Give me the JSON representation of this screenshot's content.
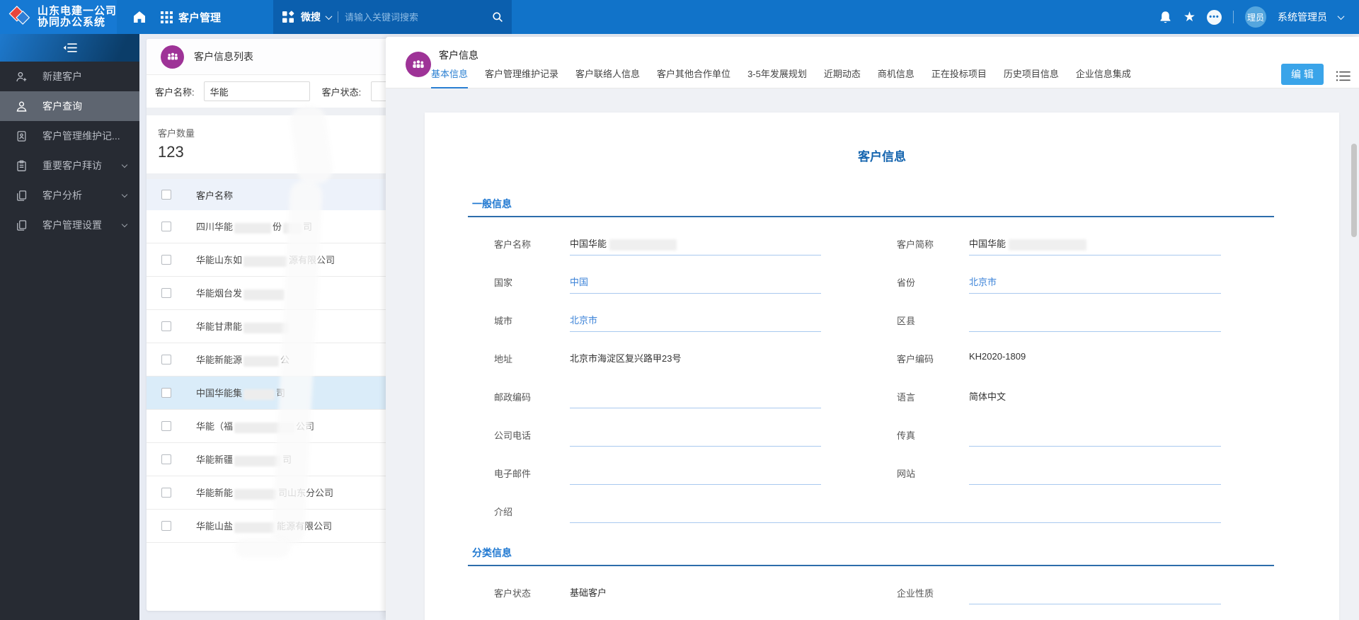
{
  "header": {
    "logo_line1": "山东电建一公司",
    "logo_line2": "协同办公系统",
    "nav_app": "客户管理",
    "wesearch": "微搜",
    "search_placeholder": "请输入关键词搜索",
    "avatar_text": "理员",
    "username": "系统管理员",
    "colors": {
      "bar": "#1173c9",
      "search_panel": "#0b5fae"
    }
  },
  "sidebar": {
    "items": [
      {
        "label": "新建客户",
        "icon": "user-add-icon",
        "selected": false,
        "chevron": false
      },
      {
        "label": "客户查询",
        "icon": "user-icon",
        "selected": true,
        "chevron": false
      },
      {
        "label": "客户管理维护记...",
        "icon": "card-user-icon",
        "selected": false,
        "chevron": false
      },
      {
        "label": "重要客户拜访",
        "icon": "clipboard-icon",
        "selected": false,
        "chevron": true
      },
      {
        "label": "客户分析",
        "icon": "docs-icon",
        "selected": false,
        "chevron": true
      },
      {
        "label": "客户管理设置",
        "icon": "docs-icon",
        "selected": false,
        "chevron": true
      }
    ]
  },
  "list_panel": {
    "title": "客户信息列表",
    "filter_name_label": "客户名称:",
    "filter_name_value": "华能",
    "filter_status_label": "客户状态:",
    "count_label": "客户数量",
    "count_value": "123",
    "table_header": "客户名称",
    "rows": [
      {
        "segments": [
          {
            "t": "四川华能"
          },
          {
            "b": 52
          },
          {
            "t": "份"
          },
          {
            "b": 26
          },
          {
            "t": "司"
          }
        ],
        "selected": false
      },
      {
        "segments": [
          {
            "t": "华能山东如"
          },
          {
            "b": 62
          },
          {
            "t": "源有限公司"
          }
        ],
        "selected": false
      },
      {
        "segments": [
          {
            "t": "华能烟台发"
          },
          {
            "b": 58
          }
        ],
        "selected": false
      },
      {
        "segments": [
          {
            "t": "华能甘肃能"
          },
          {
            "b": 64
          }
        ],
        "selected": false
      },
      {
        "segments": [
          {
            "t": "华能新能源"
          },
          {
            "b": 50
          },
          {
            "t": "公"
          }
        ],
        "selected": false
      },
      {
        "segments": [
          {
            "t": "中国华能集"
          },
          {
            "b": 44
          },
          {
            "t": "司"
          }
        ],
        "selected": true
      },
      {
        "segments": [
          {
            "t": "华能（福"
          },
          {
            "b": 85
          },
          {
            "t": "公司"
          }
        ],
        "selected": false
      },
      {
        "segments": [
          {
            "t": "华能新疆"
          },
          {
            "b": 66
          },
          {
            "t": "司"
          }
        ],
        "selected": false
      },
      {
        "segments": [
          {
            "t": "华能新能"
          },
          {
            "b": 60
          },
          {
            "t": "司山东分公司"
          }
        ],
        "selected": false
      },
      {
        "segments": [
          {
            "t": "华能山盐"
          },
          {
            "b": 58
          },
          {
            "t": "能源有限公司"
          }
        ],
        "selected": false
      }
    ]
  },
  "detail": {
    "title": "客户信息",
    "edit_button": "编 辑",
    "tabs": [
      {
        "label": "基本信息",
        "active": true
      },
      {
        "label": "客户管理维护记录",
        "active": false
      },
      {
        "label": "客户联络人信息",
        "active": false
      },
      {
        "label": "客户其他合作单位",
        "active": false
      },
      {
        "label": "3-5年发展规划",
        "active": false
      },
      {
        "label": "近期动态",
        "active": false
      },
      {
        "label": "商机信息",
        "active": false
      },
      {
        "label": "正在投标项目",
        "active": false
      },
      {
        "label": "历史项目信息",
        "active": false
      },
      {
        "label": "企业信息集成",
        "active": false
      }
    ],
    "form": {
      "title": "客户信息",
      "sections": [
        {
          "title": "一般信息",
          "rows": [
            {
              "cells": [
                {
                  "label": "客户名称",
                  "value": "中国华能",
                  "blur": 95,
                  "underline": true
                },
                {
                  "label": "客户简称",
                  "value": "中国华能",
                  "blur": 110,
                  "underline": true
                }
              ]
            },
            {
              "cells": [
                {
                  "label": "国家",
                  "value": "中国",
                  "link": true,
                  "underline": true
                },
                {
                  "label": "省份",
                  "value": "北京市",
                  "link": true,
                  "underline": true
                }
              ]
            },
            {
              "cells": [
                {
                  "label": "城市",
                  "value": "北京市",
                  "link": true,
                  "underline": true
                },
                {
                  "label": "区县",
                  "value": "",
                  "underline": true
                }
              ]
            },
            {
              "cells": [
                {
                  "label": "地址",
                  "value": "北京市海淀区复兴路甲23号",
                  "underline": false
                },
                {
                  "label": "客户编码",
                  "value": "KH2020-1809",
                  "underline": false
                }
              ]
            },
            {
              "cells": [
                {
                  "label": "邮政编码",
                  "value": "",
                  "underline": true
                },
                {
                  "label": "语言",
                  "value": "简体中文",
                  "underline": false
                }
              ]
            },
            {
              "cells": [
                {
                  "label": "公司电话",
                  "value": "",
                  "underline": true
                },
                {
                  "label": "传真",
                  "value": "",
                  "underline": true
                }
              ]
            },
            {
              "cells": [
                {
                  "label": "电子邮件",
                  "value": "",
                  "underline": true
                },
                {
                  "label": "网站",
                  "value": "",
                  "underline": true
                }
              ]
            },
            {
              "cells": [
                {
                  "label": "介绍",
                  "value": "",
                  "underline": true,
                  "full": true
                }
              ]
            }
          ]
        },
        {
          "title": "分类信息",
          "rows": [
            {
              "cells": [
                {
                  "label": "客户状态",
                  "value": "基础客户",
                  "underline": false
                },
                {
                  "label": "企业性质",
                  "value": "",
                  "underline": true
                }
              ]
            }
          ]
        }
      ]
    },
    "accent": "#2a7fd2"
  }
}
